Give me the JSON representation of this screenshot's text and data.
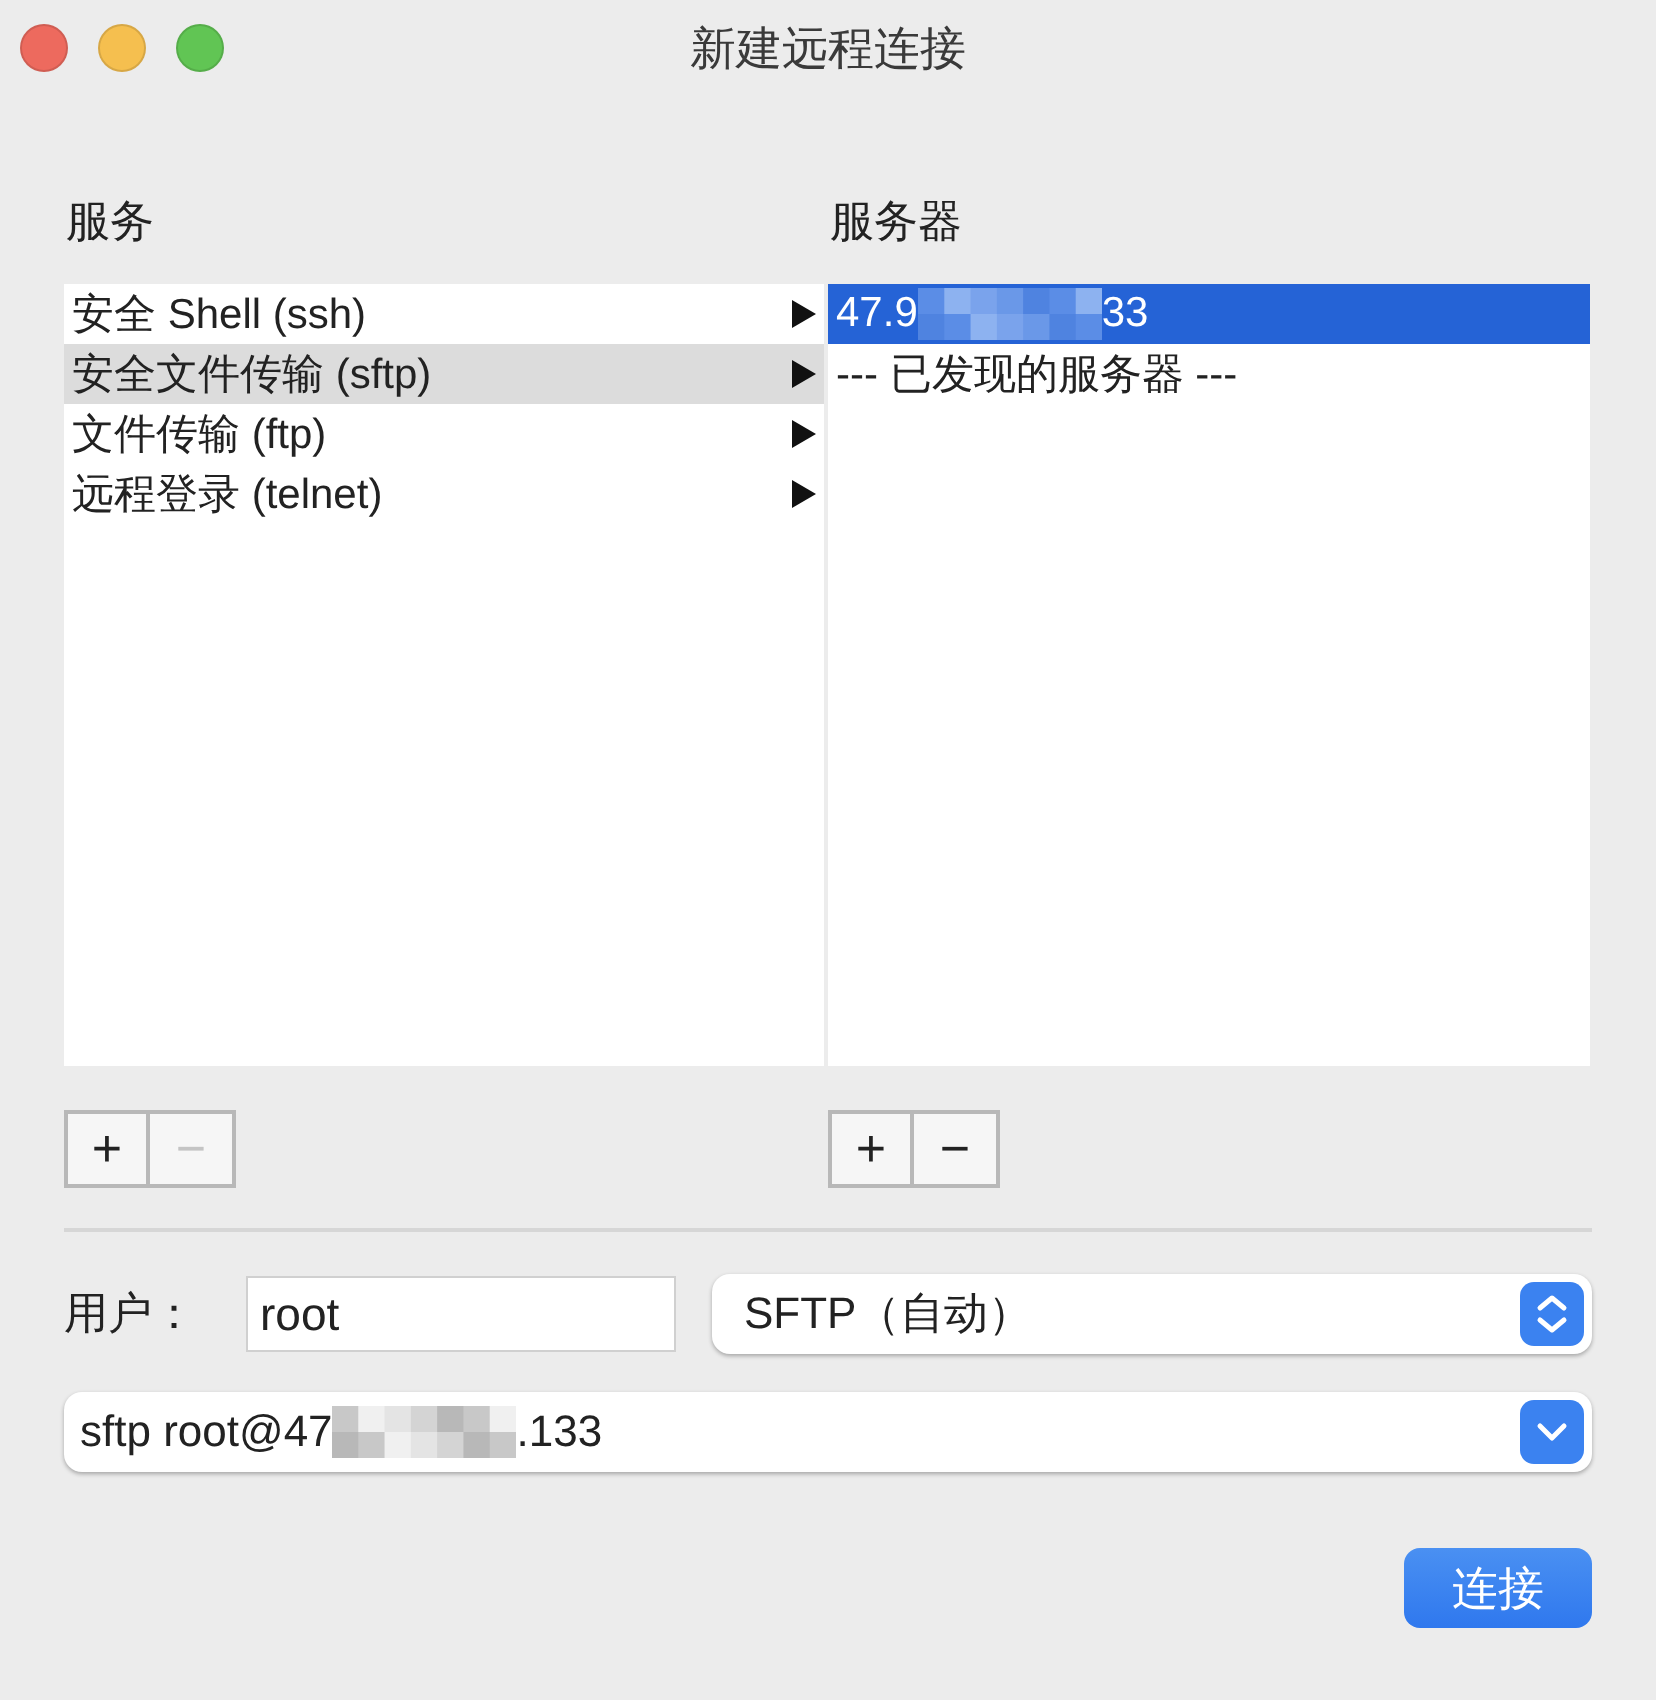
{
  "window": {
    "title": "新建远程连接"
  },
  "services": {
    "heading": "服务",
    "items": [
      {
        "label": "安全 Shell (ssh)",
        "selected": false
      },
      {
        "label": "安全文件传输 (sftp)",
        "selected": true
      },
      {
        "label": "文件传输 (ftp)",
        "selected": false
      },
      {
        "label": "远程登录 (telnet)",
        "selected": false
      }
    ],
    "add": {
      "label": "+",
      "disabled": false
    },
    "remove": {
      "label": "−",
      "disabled": true
    }
  },
  "servers": {
    "heading": "服务器",
    "items": [
      {
        "kind": "redacted",
        "text_before": "47.9",
        "text_after": "33",
        "selected": true
      },
      {
        "kind": "text",
        "text": "--- 已发现的服务器 ---",
        "selected": false
      }
    ],
    "add": {
      "label": "+",
      "disabled": false
    },
    "remove": {
      "label": "−",
      "disabled": false
    }
  },
  "user": {
    "label": "用户：",
    "value": "root"
  },
  "protocol": {
    "value": "SFTP（自动）"
  },
  "command": {
    "text_before": "sftp root@47",
    "text_after": ".133"
  },
  "connect_button": "连接"
}
